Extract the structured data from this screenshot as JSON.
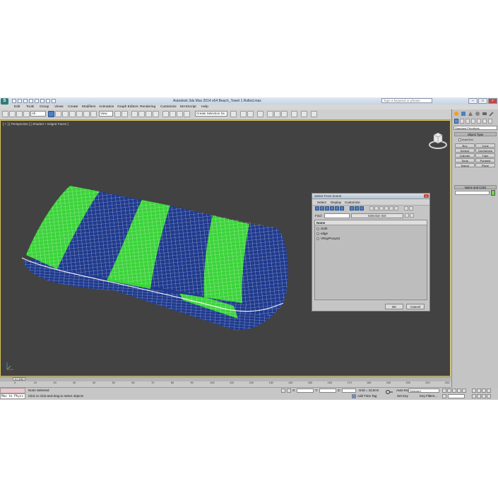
{
  "title_bar": {
    "app_title": "Autodesk 3ds Max  2014 x64      Beach_Towel 1 Rolled.max",
    "search_placeholder": "Type a keyword or phrase",
    "minimize": "–",
    "maximize": "□",
    "close": "×"
  },
  "menu": [
    "Edit",
    "Tools",
    "Group",
    "Views",
    "Create",
    "Modifiers",
    "Animation",
    "Graph Editors",
    "Rendering",
    "Customize",
    "MAXScript",
    "Help"
  ],
  "toolbar": {
    "filter_value": "All",
    "ref_coord_value": "View",
    "named_selection_value": "Create Selection Se"
  },
  "viewport": {
    "label": "[ + ] [ Perspective ] [ Shaded + Edged Faces ]",
    "colors": {
      "green": "#3bd43a",
      "blue": "#1f3a8e",
      "wire": "#ffffff"
    }
  },
  "command_panel": {
    "category_value": "Standard Primitives",
    "rollout_object_type": "Object Type",
    "autogrid_label": "AutoGrid",
    "object_buttons": [
      "Box",
      "Cone",
      "Sphere",
      "GeoSphere",
      "Cylinder",
      "Tube",
      "Torus",
      "Pyramid",
      "Teapot",
      "Plane"
    ],
    "rollout_name_color": "Name and Color",
    "swatch_color": "#6ad84a"
  },
  "dialog": {
    "title": "Select From Scene",
    "menu": [
      "Select",
      "Display",
      "Customize"
    ],
    "find_label": "Find:",
    "selection_set": "Selection Set:",
    "column_name": "Name",
    "rows": [
      "cloth",
      "edge",
      "VRayProxy01"
    ],
    "ok": "OK",
    "cancel": "Cancel"
  },
  "timeline": {
    "frame_readout": "0 / 100",
    "ticks": [
      "0",
      "10",
      "20",
      "30",
      "40",
      "50",
      "60",
      "70",
      "80",
      "90",
      "100",
      "110",
      "120",
      "130",
      "140",
      "150",
      "160",
      "170",
      "180",
      "190",
      "200",
      "210",
      "220"
    ]
  },
  "status": {
    "maxscript_text": "Max to Physc",
    "selection_text": "None Selected",
    "prompt_text": "Click or click-and-drag to select objects",
    "grid_text": "Grid = 10,0cm",
    "auto_key": "Auto Key",
    "auto_key_value": "Selected",
    "set_key": "Set Key",
    "key_filters": "Key Filters...",
    "add_time_tag": "Add Time Tag",
    "coord_x": "X:",
    "coord_y": "Y:",
    "coord_z": "Z:"
  }
}
